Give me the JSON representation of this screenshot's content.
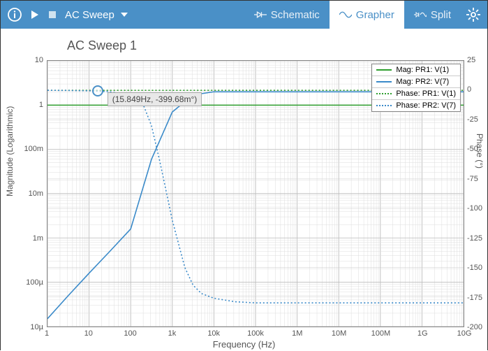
{
  "toolbar": {
    "mode_label": "AC Sweep",
    "tabs": {
      "schematic": "Schematic",
      "grapher": "Grapher",
      "split": "Split"
    }
  },
  "chart_title": "AC Sweep 1",
  "axes": {
    "xlabel": "Frequency (Hz)",
    "ylabel_left": "Magnitude (Logarithmic)",
    "ylabel_right": "Phase (°)",
    "xticks": [
      "1",
      "10",
      "100",
      "1k",
      "10k",
      "100k",
      "1M",
      "10M",
      "100M",
      "1G",
      "10G"
    ],
    "yticks_left": [
      "10",
      "1",
      "100m",
      "10m",
      "1m",
      "100µ",
      "10µ"
    ],
    "yticks_right": [
      "25",
      "0",
      "-25",
      "-50",
      "-75",
      "-100",
      "-125",
      "-150",
      "-175",
      "-200"
    ]
  },
  "legend": [
    {
      "label": "Mag: PR1: V(1)",
      "color": "#2e9e2e",
      "style": "solid"
    },
    {
      "label": "Mag: PR2: V(7)",
      "color": "#3a8ac9",
      "style": "solid"
    },
    {
      "label": "Phase: PR1: V(1)",
      "color": "#2e9e2e",
      "style": "dotted"
    },
    {
      "label": "Phase: PR2: V(7)",
      "color": "#3a8ac9",
      "style": "dotted"
    }
  ],
  "cursor": {
    "label": "(15.849Hz, -399.68m°)"
  },
  "chart_data": {
    "type": "line",
    "title": "AC Sweep 1",
    "xlabel": "Frequency (Hz)",
    "x_scale": "log",
    "x_range": [
      1,
      10000000000.0
    ],
    "y_left": {
      "label": "Magnitude (Logarithmic)",
      "scale": "log",
      "range": [
        1e-05,
        10
      ]
    },
    "y_right": {
      "label": "Phase (°)",
      "scale": "linear",
      "range": [
        -200,
        25
      ]
    },
    "series": [
      {
        "name": "Mag: PR1: V(1)",
        "axis": "left",
        "color": "#2e9e2e",
        "style": "solid",
        "x": [
          1,
          10,
          100,
          1000,
          10000.0,
          100000.0,
          1000000.0,
          10000000.0,
          100000000.0,
          1000000000.0,
          10000000000.0
        ],
        "y": [
          1,
          1,
          1,
          1,
          1,
          1,
          1,
          1,
          1,
          1,
          1
        ]
      },
      {
        "name": "Mag: PR2: V(7)",
        "axis": "left",
        "color": "#3a8ac9",
        "style": "solid",
        "x": [
          1,
          3.16,
          10,
          31.6,
          100,
          316,
          1000,
          3160,
          10000.0,
          100000.0,
          1000000.0,
          10000000.0,
          100000000.0,
          1000000000.0,
          10000000000.0
        ],
        "y": [
          1.5e-05,
          5e-05,
          0.00016,
          0.0005,
          0.0016,
          0.06,
          0.7,
          1.7,
          2.0,
          2.0,
          2.0,
          2.0,
          2.0,
          2.0,
          2.0
        ]
      },
      {
        "name": "Phase: PR1: V(1)",
        "axis": "right",
        "color": "#2e9e2e",
        "style": "dotted",
        "x": [
          1,
          10,
          100,
          1000,
          10000.0,
          100000.0,
          1000000.0,
          10000000.0,
          100000000.0,
          1000000000.0,
          10000000000.0
        ],
        "y": [
          0,
          0,
          0,
          0,
          0,
          0,
          0,
          0,
          0,
          0,
          0
        ]
      },
      {
        "name": "Phase: PR2: V(7)",
        "axis": "right",
        "color": "#3a8ac9",
        "style": "dotted",
        "x": [
          1,
          3.16,
          10,
          31.6,
          100,
          200,
          316,
          500,
          1000,
          2000,
          3160,
          5000,
          10000.0,
          31600.0,
          100000.0,
          1000000.0,
          10000000.0,
          100000000.0,
          1000000000.0,
          10000000000.0
        ],
        "y": [
          0,
          -0.1,
          -0.4,
          -1.2,
          -4,
          -12,
          -30,
          -60,
          -110,
          -150,
          -165,
          -172,
          -176,
          -179,
          -180,
          -180,
          -180,
          -180,
          -180,
          -180
        ]
      }
    ],
    "cursor": {
      "x": 15.849,
      "y_phase": -0.39968,
      "label": "(15.849Hz, -399.68m°)"
    }
  }
}
